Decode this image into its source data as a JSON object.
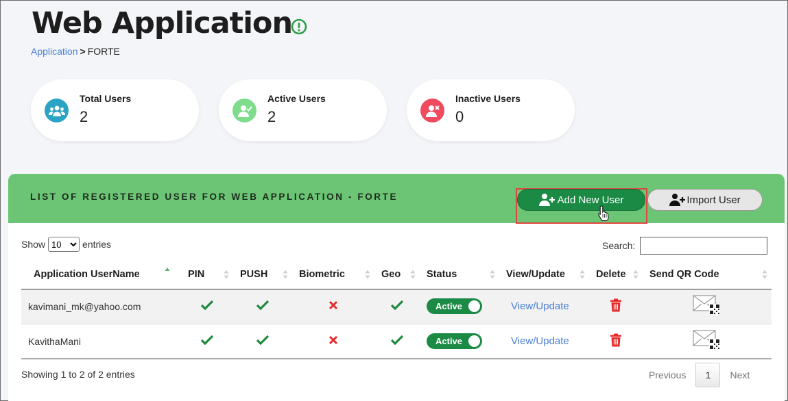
{
  "page": {
    "title": "Web Application",
    "breadcrumb": {
      "link": "Application",
      "separator": ">",
      "current": "FORTE"
    }
  },
  "stats": [
    {
      "label": "Total Users",
      "value": "2",
      "icon": "users-icon",
      "color": "#2aa3c4"
    },
    {
      "label": "Active Users",
      "value": "2",
      "icon": "user-check-icon",
      "color": "#7fdc8c"
    },
    {
      "label": "Inactive Users",
      "value": "0",
      "icon": "user-x-icon",
      "color": "#ef4a5e"
    }
  ],
  "panel": {
    "title": "LIST OF REGISTERED USER FOR WEB APPLICATION - FORTE",
    "add_button": "Add New User",
    "import_button": "Import User"
  },
  "table_controls": {
    "show_label": "Show",
    "page_size": "10",
    "entries_label": "entries",
    "search_label": "Search:"
  },
  "columns": [
    "Application UserName",
    "PIN",
    "PUSH",
    "Biometric",
    "Geo",
    "Status",
    "View/Update",
    "Delete",
    "Send QR Code"
  ],
  "rows": [
    {
      "username": "kavimani_mk@yahoo.com",
      "pin": true,
      "push": true,
      "biometric": false,
      "geo": true,
      "status": "Active",
      "view": "View/Update"
    },
    {
      "username": "KavithaMani",
      "pin": true,
      "push": true,
      "biometric": false,
      "geo": true,
      "status": "Active",
      "view": "View/Update"
    }
  ],
  "footer": {
    "info": "Showing 1 to 2 of 2 entries",
    "previous": "Previous",
    "page": "1",
    "next": "Next"
  },
  "colors": {
    "accent_green": "#1b8a45",
    "header_green": "#6cc574",
    "link_blue": "#4a7fd6",
    "danger_red": "#e52b2b"
  }
}
